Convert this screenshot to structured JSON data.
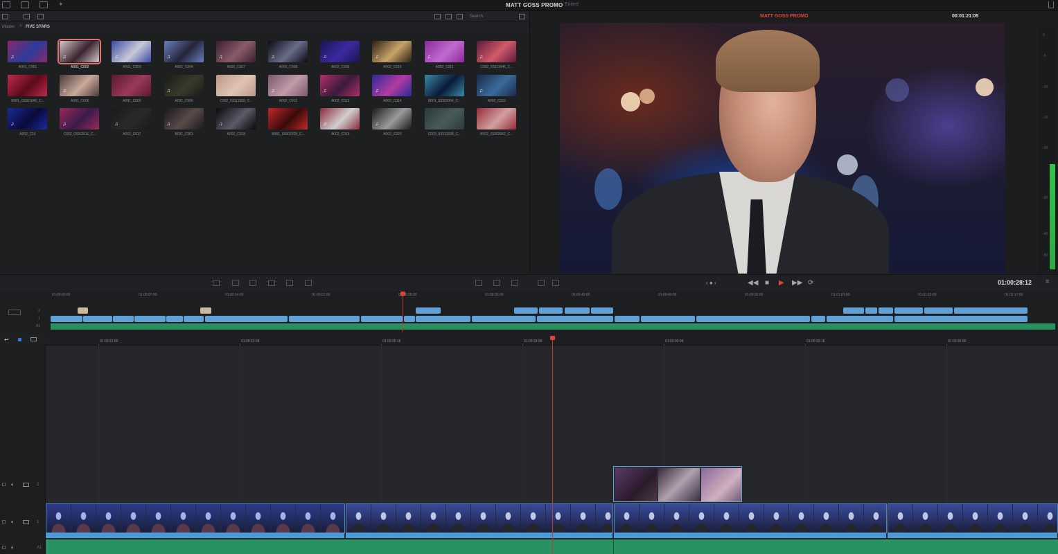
{
  "topbar": {
    "title": "MATT GOSS PROMO",
    "status": "Edited"
  },
  "media_pool": {
    "search_placeholder": "Search",
    "breadcrumb": {
      "root": "Master",
      "separator": ">",
      "current": "FIVE STARS"
    },
    "clips": [
      {
        "name": "A001_C001",
        "audio": true,
        "selected": false,
        "colors": [
          "#8a2a6a",
          "#2b3b9a"
        ]
      },
      {
        "name": "A001_C002",
        "audio": true,
        "selected": true,
        "colors": [
          "#d5c7c7",
          "#3a2430"
        ]
      },
      {
        "name": "A001_C003",
        "audio": true,
        "selected": false,
        "colors": [
          "#3a4aa5",
          "#c9c9d6"
        ]
      },
      {
        "name": "A001_C004",
        "audio": true,
        "selected": false,
        "colors": [
          "#6a7fbf",
          "#24253a"
        ]
      },
      {
        "name": "A002_C007",
        "audio": true,
        "selected": false,
        "colors": [
          "#3a1f2f",
          "#8a5a6a"
        ]
      },
      {
        "name": "A002_C008",
        "audio": true,
        "selected": false,
        "colors": [
          "#0a0a12",
          "#6a6d8a"
        ]
      },
      {
        "name": "A002_C009",
        "audio": true,
        "selected": false,
        "colors": [
          "#1a1550",
          "#3a2aa0"
        ]
      },
      {
        "name": "A002_C010",
        "audio": true,
        "selected": false,
        "colors": [
          "#2a2014",
          "#c9a36a"
        ]
      },
      {
        "name": "A002_C011",
        "audio": true,
        "selected": false,
        "colors": [
          "#8a2a9a",
          "#c06ad0"
        ]
      },
      {
        "name": "C002_03311946_C...",
        "audio": true,
        "selected": false,
        "colors": [
          "#5a1a3a",
          "#d05a6a"
        ]
      },
      {
        "name": "B001_03301946_C...",
        "audio": false,
        "selected": false,
        "colors": [
          "#c02a4a",
          "#5a0a1a"
        ]
      },
      {
        "name": "A001_C005",
        "audio": true,
        "selected": false,
        "colors": [
          "#4a3a3a",
          "#c9a99a"
        ]
      },
      {
        "name": "A001_C005",
        "audio": false,
        "selected": false,
        "colors": [
          "#5a1a2a",
          "#9a3a5a"
        ]
      },
      {
        "name": "A001_C006",
        "audio": true,
        "selected": false,
        "colors": [
          "#1a1a1a",
          "#3a3a2a"
        ]
      },
      {
        "name": "C002_03311959_C...",
        "audio": false,
        "selected": false,
        "colors": [
          "#b9988a",
          "#e0c4b5"
        ]
      },
      {
        "name": "A002_C012",
        "audio": true,
        "selected": false,
        "colors": [
          "#7a5a6a",
          "#c09aa9"
        ]
      },
      {
        "name": "A002_C013",
        "audio": true,
        "selected": false,
        "colors": [
          "#b0306a",
          "#3a1a3a"
        ]
      },
      {
        "name": "A002_C014",
        "audio": true,
        "selected": false,
        "colors": [
          "#2a2a9a",
          "#b03aa0"
        ]
      },
      {
        "name": "B001_03302004_C...",
        "audio": false,
        "selected": false,
        "colors": [
          "#3a8aa5",
          "#0a1a3a"
        ]
      },
      {
        "name": "A002_C015",
        "audio": true,
        "selected": false,
        "colors": [
          "#1a2a4a",
          "#3a6a9a"
        ]
      },
      {
        "name": "A002_C16",
        "audio": true,
        "selected": false,
        "colors": [
          "#1a2a9a",
          "#0a0a3a"
        ]
      },
      {
        "name": "C002_03312011_C...",
        "audio": true,
        "selected": false,
        "colors": [
          "#9a2a5a",
          "#3a1a4a"
        ]
      },
      {
        "name": "A002_C017",
        "audio": true,
        "selected": false,
        "colors": [
          "#1a1a1a",
          "#2a2a2a"
        ]
      },
      {
        "name": "B001_C001",
        "audio": true,
        "selected": false,
        "colors": [
          "#1a1a1a",
          "#5a4a4a"
        ]
      },
      {
        "name": "A002_C018",
        "audio": true,
        "selected": false,
        "colors": [
          "#0a0a0a",
          "#5a5a6a"
        ]
      },
      {
        "name": "B001_03302028_C...",
        "audio": false,
        "selected": false,
        "colors": [
          "#c02a2a",
          "#3a0a0a"
        ]
      },
      {
        "name": "A002_C019",
        "audio": true,
        "selected": false,
        "colors": [
          "#8a2a3a",
          "#d0d0d0"
        ]
      },
      {
        "name": "A002_C020",
        "audio": true,
        "selected": false,
        "colors": [
          "#1a1a1a",
          "#9a9a9a"
        ]
      },
      {
        "name": "C003_03312038_C...",
        "audio": false,
        "selected": false,
        "colors": [
          "#2a3a3a",
          "#4a5a5a"
        ]
      },
      {
        "name": "B002_03302052_C...",
        "audio": false,
        "selected": false,
        "colors": [
          "#9a2a3a",
          "#d0a0a0"
        ]
      }
    ]
  },
  "viewer": {
    "title": "MATT GOSS PROMO",
    "timecode": "00:01:21:05"
  },
  "audio_meter": {
    "level": 0.42,
    "scale": [
      "0",
      "-5",
      "-10",
      "-15",
      "-20",
      "-30",
      "-40",
      "-50"
    ]
  },
  "transport": {
    "timecode": "01:00:28:12",
    "buttons": [
      "◀◀",
      "■",
      "▶",
      "▶▶",
      "⟳"
    ]
  },
  "mini_timeline": {
    "ruler": [
      "01:00:00:00",
      "01:00:07:00",
      "01:00:14:00",
      "01:00:21:00",
      "01:00:28:00",
      "01:00:35:00",
      "01:00:42:00",
      "01:00:49:00",
      "01:00:56:00",
      "01:01:03:00",
      "01:01:10:00",
      "01:01:17:00"
    ],
    "track_labels": [
      "2",
      "1",
      "A1"
    ]
  },
  "timeline": {
    "ruler": [
      "01:00:21:00",
      "01:00:23:08",
      "01:00:25:16",
      "01:00:28:00",
      "01:00:30:08",
      "01:00:32:16",
      "01:00:35:00"
    ],
    "tracks": [
      {
        "name": "V2",
        "label": "2"
      },
      {
        "name": "V1",
        "label": "1"
      },
      {
        "name": "A1",
        "label": "A1"
      }
    ]
  },
  "colors": {
    "accent": "#e0453b",
    "video_clip": "#5fa0d6",
    "audio_clip": "#2a9163"
  }
}
